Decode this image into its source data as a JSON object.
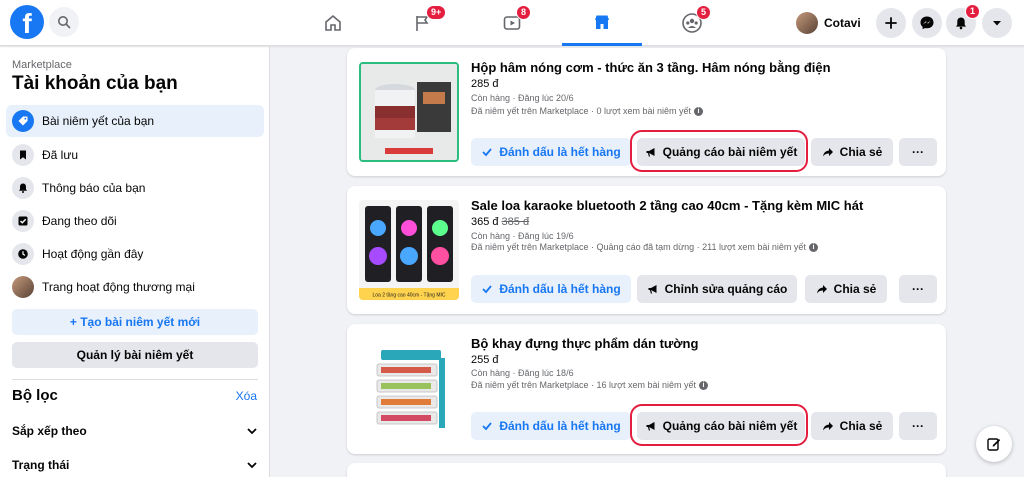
{
  "topbar": {
    "logo_letter": "f",
    "tabs": [
      {
        "id": "home",
        "icon": "home-icon",
        "badge": ""
      },
      {
        "id": "pages",
        "icon": "flag-icon",
        "badge": "9+"
      },
      {
        "id": "watch",
        "icon": "video-icon",
        "badge": "8"
      },
      {
        "id": "marketplace",
        "icon": "store-icon",
        "badge": ""
      },
      {
        "id": "groups",
        "icon": "groups-icon",
        "badge": "5"
      }
    ],
    "profile_name": "Cotavi",
    "notifications_badge": "1",
    "accent_color": "#1877f2",
    "badge_color": "#e41e3f"
  },
  "sidebar": {
    "eyebrow": "Marketplace",
    "title": "Tài khoản của bạn",
    "items": [
      {
        "label": "Bài niêm yết của bạn",
        "icon": "tag-icon"
      },
      {
        "label": "Đã lưu",
        "icon": "bookmark-icon"
      },
      {
        "label": "Thông báo của bạn",
        "icon": "bell-icon"
      },
      {
        "label": "Đang theo dõi",
        "icon": "check-box-icon"
      },
      {
        "label": "Hoạt động gần đây",
        "icon": "clock-icon"
      },
      {
        "label": "Trang hoạt động thương mại",
        "icon": "avatar"
      }
    ],
    "create_label": "+ Tạo bài niêm yết mới",
    "manage_label": "Quản lý bài niêm yết",
    "filter_title": "Bộ lọc",
    "filter_clear": "Xóa",
    "filter_rows": [
      "Sắp xếp theo",
      "Trạng thái"
    ]
  },
  "listings": [
    {
      "title": "Hộp hâm nóng cơm - thức ăn 3 tầng. Hâm nóng bằng điện",
      "price": "285 đ",
      "old_price": "",
      "meta1": "Còn hàng · Đăng lúc 20/6",
      "meta2": "Đã niêm yết trên Marketplace · 0 lượt xem bài niêm yết",
      "mark_sold": "Đánh dấu là hết hàng",
      "promote": "Quảng cáo bài niêm yết",
      "share": "Chia sẻ",
      "thumb_caption": ""
    },
    {
      "title": "Sale loa karaoke bluetooth 2 tầng cao 40cm - Tặng kèm MIC hát",
      "price": "365 đ",
      "old_price": "385 đ",
      "meta1": "Còn hàng · Đăng lúc 19/6",
      "meta2": "Đã niêm yết trên Marketplace · Quảng cáo đã tạm dừng · 211 lượt xem bài niêm yết",
      "mark_sold": "Đánh dấu là hết hàng",
      "promote": "Chỉnh sửa quảng cáo",
      "share": "Chia sẻ",
      "thumb_caption": "Loa 2 tầng cao 40cm - Tặng MIC"
    },
    {
      "title": "Bộ khay đựng thực phẩm dán tường",
      "price": "255 đ",
      "old_price": "",
      "meta1": "Còn hàng · Đăng lúc 18/6",
      "meta2": "Đã niêm yết trên Marketplace · 16 lượt xem bài niêm yết",
      "mark_sold": "Đánh dấu là hết hàng",
      "promote": "Quảng cáo bài niêm yết",
      "share": "Chia sẻ",
      "thumb_caption": ""
    }
  ],
  "more_label": "···"
}
